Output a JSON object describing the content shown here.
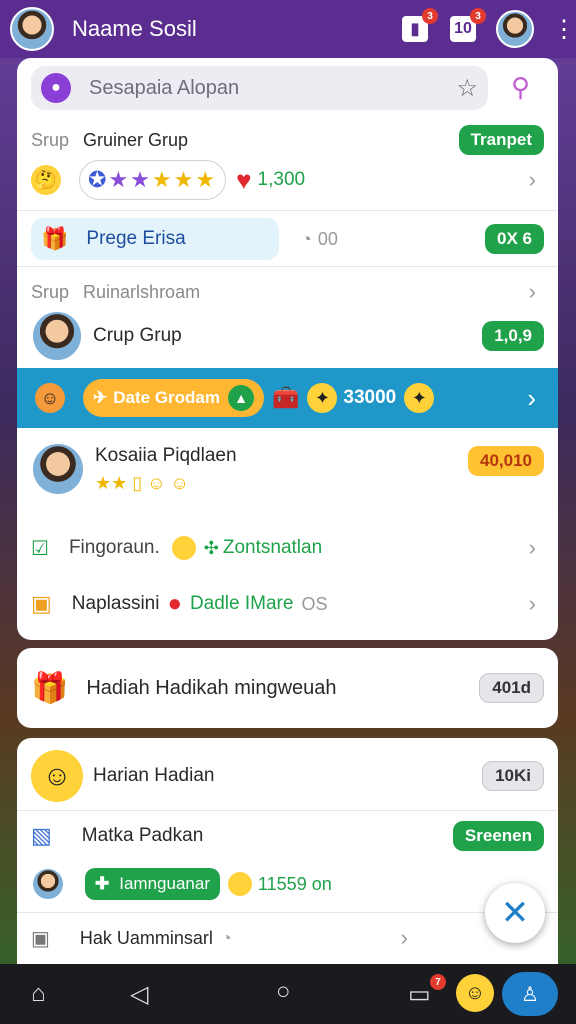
{
  "header": {
    "title": "Naame Sosil",
    "badge_a": "3",
    "badge_b": "3",
    "mail_label": "10"
  },
  "search": {
    "placeholder": "Sesapaia Alopan"
  },
  "rows": {
    "group1_label": "Srup",
    "group1_name": "Gruiner Grup",
    "group1_pill": "Tranpet",
    "score_value": "1,300",
    "promo_label": "Prege Erisa",
    "promo_side": "00",
    "promo_pill": "0X 6",
    "group2_label": "Srup",
    "group2_name": "Ruinarlshroam",
    "crup_name": "Crup Grup",
    "crup_pill": "1,0,9",
    "band_pill": "Date Grodam",
    "band_value": "33000",
    "kosaia_name": "Kosaiia Piqdlaen",
    "kosaia_pill": "40,010",
    "fingo_name": "Fingoraun.",
    "fingo_extra": "Zontsnatlan",
    "napla_name": "Naplassini",
    "napla_green": "Dadle IMare",
    "napla_side": "OS"
  },
  "hadiah": {
    "name": "Hadiah Hadikah mingweuah",
    "pill": "401d"
  },
  "list3": {
    "item1_name": "Harian Hadian",
    "item1_pill": "10Ki",
    "item2_name": "Matka Padkan",
    "item2_pill": "Sreenen",
    "item3_green": "Iamnguanar",
    "item3_value": "11559 on",
    "item4_name": "Hak Uamminsarl"
  },
  "nav": {
    "badge": "7"
  },
  "colors": {
    "header": "#5b2d91",
    "band": "#1f97c8",
    "green": "#1fa24a"
  }
}
